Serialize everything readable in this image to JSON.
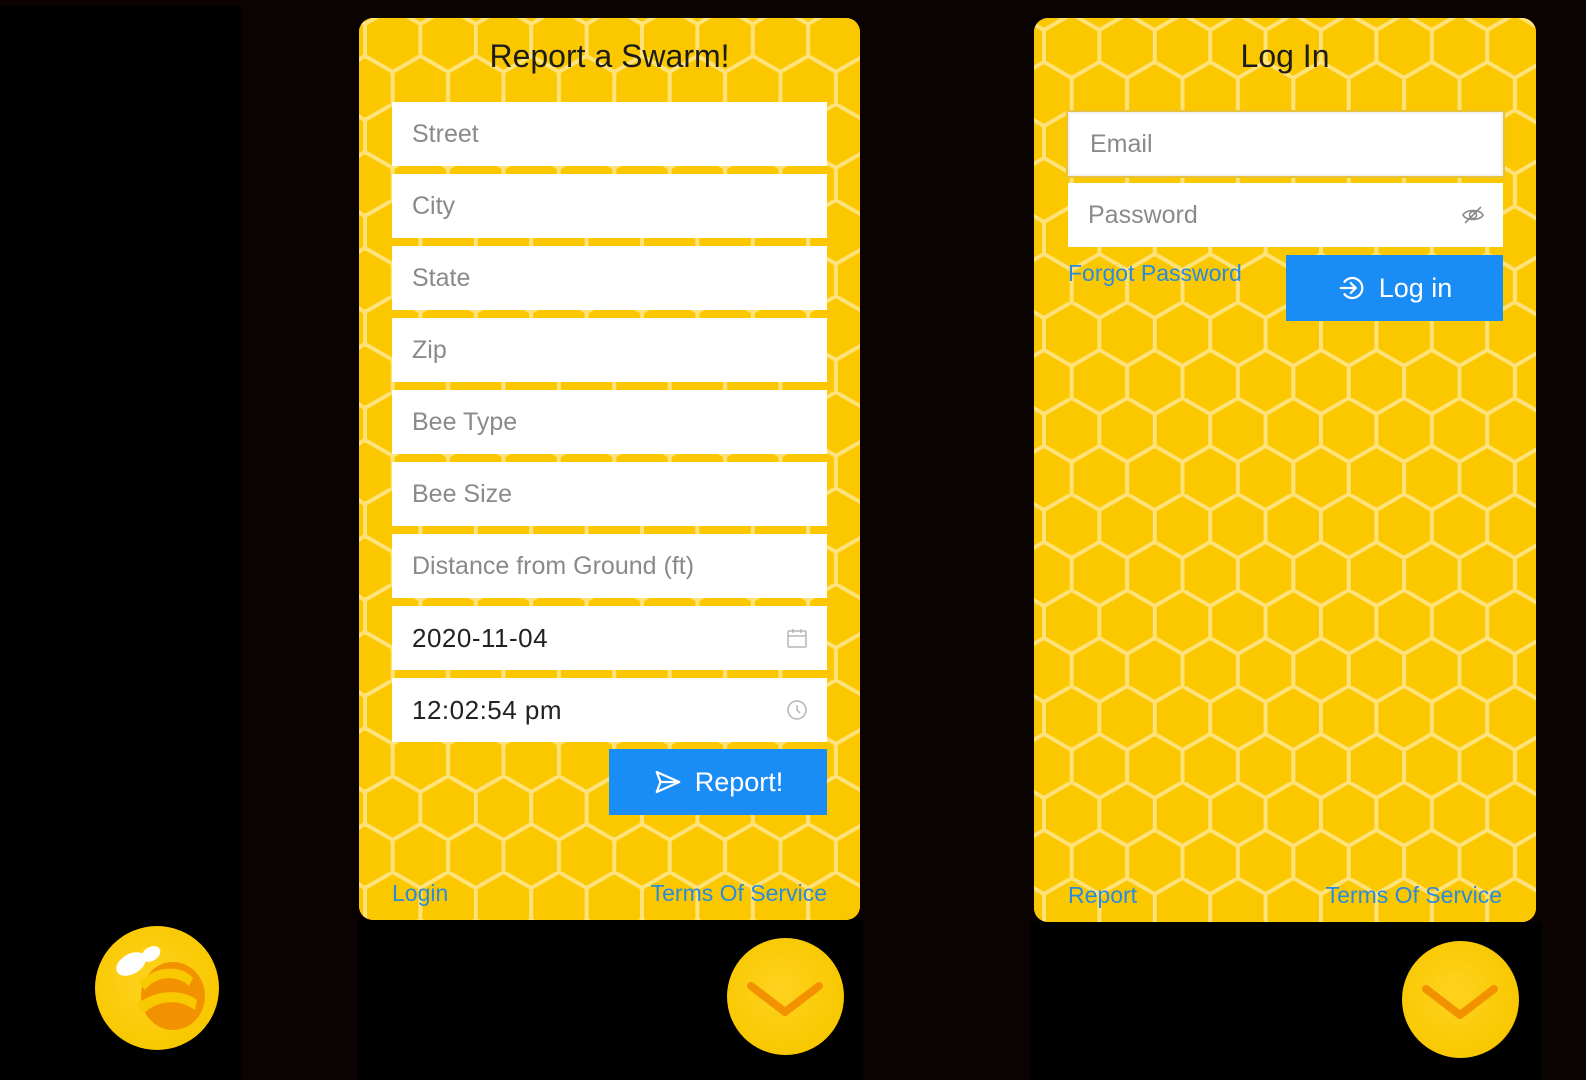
{
  "report_screen": {
    "title": "Report a Swarm!",
    "fields": [
      {
        "placeholder": "Street",
        "value": ""
      },
      {
        "placeholder": "City",
        "value": ""
      },
      {
        "placeholder": "State",
        "value": ""
      },
      {
        "placeholder": "Zip",
        "value": ""
      },
      {
        "placeholder": "Bee Type",
        "value": ""
      },
      {
        "placeholder": "Bee Size",
        "value": ""
      },
      {
        "placeholder": "Distance from Ground (ft)",
        "value": ""
      }
    ],
    "date_value": "2020-11-04",
    "time_value": "12:02:54 pm",
    "report_button_label": "Report!",
    "footer": {
      "left_link": "Login",
      "right_link": "Terms Of Service"
    }
  },
  "login_screen": {
    "title": "Log In",
    "email_placeholder": "Email",
    "password_placeholder": "Password",
    "forgot_password_label": "Forgot Password",
    "login_button_label": "Log in",
    "footer": {
      "left_link": "Report",
      "right_link": "Terms Of Service"
    }
  },
  "icons": {
    "calendar": "calendar-icon",
    "clock": "clock-icon",
    "send": "send-icon",
    "login": "login-icon",
    "eye_off": "eye-off-icon",
    "bee_logo": "bee-logo-icon",
    "chevron": "chevron-down-icon"
  },
  "colors": {
    "honey_yellow": "#fbc800",
    "hex_line": "#ffe780",
    "primary_blue": "#1a8cf5",
    "link_blue": "#2a8bdc",
    "bee_orange": "#f39200"
  }
}
